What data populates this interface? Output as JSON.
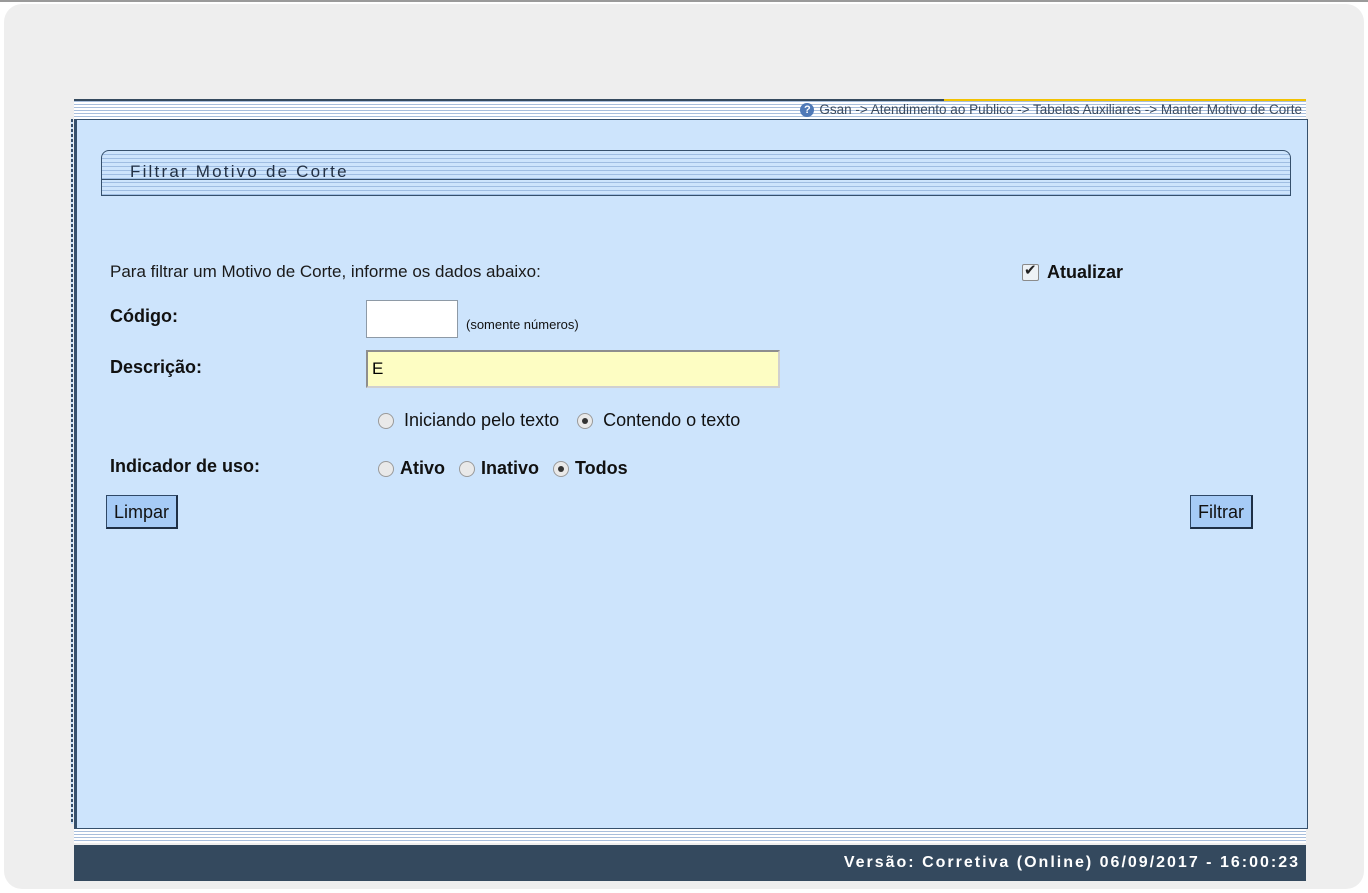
{
  "breadcrumb": {
    "text": "Gsan -> Atendimento ao Publico -> Tabelas Auxiliares -> Manter Motivo de Corte"
  },
  "form": {
    "title": "Filtrar Motivo de Corte",
    "intro": "Para filtrar um Motivo de Corte, informe os dados abaixo:",
    "atualizar_label": "Atualizar",
    "atualizar_checked": true,
    "codigo_label": "Código:",
    "codigo_value": "",
    "codigo_hint": "(somente números)",
    "descricao_label": "Descrição:",
    "descricao_value": "E",
    "match_options": [
      {
        "label": "Iniciando pelo texto",
        "selected": false
      },
      {
        "label": "Contendo o texto",
        "selected": true
      }
    ],
    "indicador_label": "Indicador de uso:",
    "indicador_options": [
      {
        "label": "Ativo",
        "selected": false
      },
      {
        "label": "Inativo",
        "selected": false
      },
      {
        "label": "Todos",
        "selected": true
      }
    ],
    "limpar_label": "Limpar",
    "filtrar_label": "Filtrar"
  },
  "footer": {
    "text": "Versão: Corretiva (Online) 06/09/2017 - 16:00:23"
  },
  "colors": {
    "panel_bg": "#cde4fc",
    "footer_bg": "#34495e",
    "input_highlight": "#fdfdc3",
    "button_bg": "#a6cbf6"
  }
}
